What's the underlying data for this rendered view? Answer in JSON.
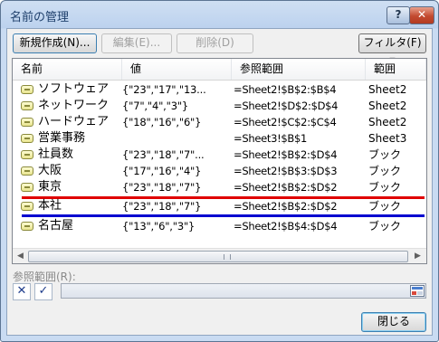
{
  "window": {
    "title": "名前の管理",
    "help_glyph": "?",
    "close_glyph": "✕"
  },
  "toolbar": {
    "new_label": "新規作成(N)...",
    "edit_label": "編集(E)...",
    "delete_label": "削除(D)",
    "filter_label": "フィルタ(F) ▾"
  },
  "columns": [
    "名前",
    "値",
    "参照範囲",
    "範囲"
  ],
  "rows": [
    {
      "name": "ソフトウェア",
      "value": "{\"23\",\"17\",\"13...",
      "ref": "=Sheet2!$B$2:$B$4",
      "scope": "Sheet2"
    },
    {
      "name": "ネットワーク",
      "value": "{\"7\",\"4\",\"3\"}",
      "ref": "=Sheet2!$D$2:$D$4",
      "scope": "Sheet2"
    },
    {
      "name": "ハードウェア",
      "value": "{\"18\",\"16\",\"6\"}",
      "ref": "=Sheet2!$C$2:$C$4",
      "scope": "Sheet2"
    },
    {
      "name": "営業事務",
      "value": "",
      "ref": "=Sheet3!$B$1",
      "scope": "Sheet3"
    },
    {
      "name": "社員数",
      "value": "{\"23\",\"18\",\"7\"...",
      "ref": "=Sheet2!$B$2:$D$4",
      "scope": "ブック"
    },
    {
      "name": "大阪",
      "value": "{\"17\",\"16\",\"4\"}",
      "ref": "=Sheet2!$B$3:$D$3",
      "scope": "ブック"
    },
    {
      "name": "東京",
      "value": "{\"23\",\"18\",\"7\"}",
      "ref": "=Sheet2!$B$2:$D$2",
      "scope": "ブック"
    },
    {
      "name": "本社",
      "value": "{\"23\",\"18\",\"7\"}",
      "ref": "=Sheet2!$B$2:$D$2",
      "scope": "ブック"
    },
    {
      "name": "名古屋",
      "value": "{\"13\",\"6\",\"3\"}",
      "ref": "=Sheet2!$B$4:$D$4",
      "scope": "ブック"
    }
  ],
  "annotation_colors": {
    "red_line": "#e00000",
    "blue_line": "#0000d0"
  },
  "ref_field": {
    "label": "参照範囲(R):",
    "value": "",
    "cancel_glyph": "✕",
    "confirm_glyph": "✓"
  },
  "footer": {
    "close_label": "閉じる"
  }
}
